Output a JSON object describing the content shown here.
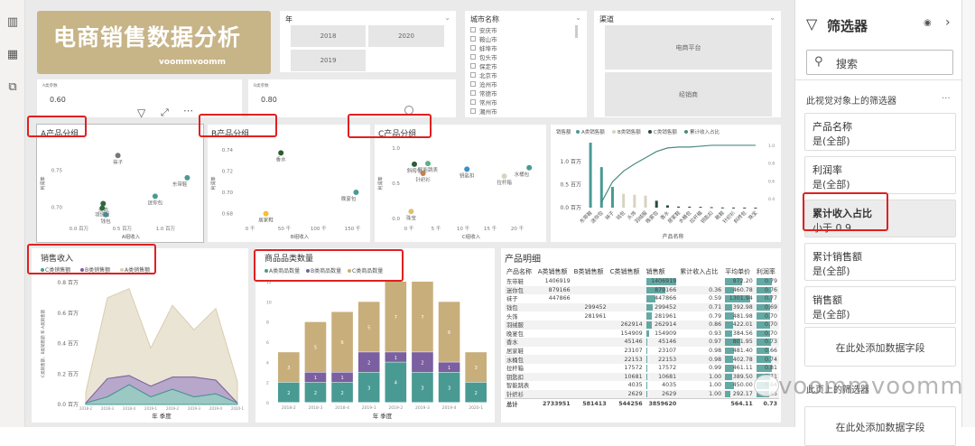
{
  "nav": {
    "icons": [
      "report-view-icon",
      "table-view-icon",
      "model-view-icon"
    ]
  },
  "banner": {
    "title": "电商销售数据分析",
    "subtitle": "voommvoomm"
  },
  "year_slicer": {
    "title": "年",
    "options": [
      "2018",
      "2020",
      "2019"
    ]
  },
  "city_slicer": {
    "title": "城市名称",
    "items": [
      "安庆市",
      "鞍山市",
      "蚌埠市",
      "包头市",
      "保定市",
      "北京市",
      "沧州市",
      "常德市",
      "常州市",
      "潮州市"
    ]
  },
  "channel_slicer": {
    "title": "渠道",
    "options": [
      "电商平台",
      "经销商"
    ]
  },
  "param_a": {
    "label": "A类参数",
    "value": "0.60"
  },
  "param_b": {
    "label": "B类参数",
    "value": "0.80"
  },
  "scatters": [
    {
      "title": "A产品分组",
      "xlabel": "A组收入",
      "ylabel": "利润率",
      "xlim": [
        -0.15,
        1.35
      ],
      "ylim": [
        0.68,
        0.785
      ],
      "xticks": [
        [
          0,
          "0.0 百万"
        ],
        [
          0.5,
          "0.5 百万"
        ],
        [
          1.0,
          "1.0 百万"
        ]
      ],
      "yticks": [
        [
          0.7,
          "0.70"
        ],
        [
          0.75,
          "0.75"
        ]
      ],
      "points": [
        {
          "label": "袜子",
          "x": 0.45,
          "y": 0.77,
          "color": "#777777"
        },
        {
          "label": "迷你包",
          "x": 0.88,
          "y": 0.715,
          "color": "#4a9a94"
        },
        {
          "label": "头饰",
          "x": 0.28,
          "y": 0.705,
          "color": "#2e6b3a"
        },
        {
          "label": "羽绒服",
          "x": 0.27,
          "y": 0.699,
          "color": "#2e6b3a"
        },
        {
          "label": "钱包",
          "x": 0.31,
          "y": 0.69,
          "color": "#4a8a94"
        },
        {
          "label": "东带鞋",
          "x": 1.25,
          "y": 0.74,
          "color": "#4a9a94"
        }
      ]
    },
    {
      "title": "B产品分组",
      "xlabel": "B组收入",
      "ylabel": "利润率",
      "xlim": [
        -20,
        165
      ],
      "ylim": [
        0.672,
        0.745
      ],
      "xticks": [
        [
          0,
          "0 千"
        ],
        [
          50,
          "50 千"
        ],
        [
          100,
          "100 千"
        ],
        [
          150,
          "150 千"
        ]
      ],
      "yticks": [
        [
          0.68,
          "0.68"
        ],
        [
          0.7,
          "0.70"
        ],
        [
          0.72,
          "0.72"
        ],
        [
          0.74,
          "0.74"
        ]
      ],
      "points": [
        {
          "label": "香水",
          "x": 45,
          "y": 0.737,
          "color": "#2e5a2e"
        },
        {
          "label": "晚宴包",
          "x": 155,
          "y": 0.7,
          "color": "#4a9a94"
        },
        {
          "label": "居家鞋",
          "x": 23,
          "y": 0.68,
          "color": "#f2c12e"
        }
      ]
    },
    {
      "title": "C产品分组",
      "xlabel": "C组收入",
      "ylabel": "利润率",
      "xlim": [
        -1,
        24
      ],
      "ylim": [
        -0.05,
        1.05
      ],
      "xticks": [
        [
          0,
          "0 千"
        ],
        [
          5,
          "5 千"
        ],
        [
          10,
          "10 千"
        ],
        [
          15,
          "15 千"
        ],
        [
          20,
          "20 千"
        ]
      ],
      "yticks": [
        [
          0,
          "0.0"
        ],
        [
          0.5,
          "0.5"
        ],
        [
          1.0,
          "1.0"
        ]
      ],
      "points": [
        {
          "label": "智能跳表",
          "x": 3.5,
          "y": 0.78,
          "color": "#5ab08a"
        },
        {
          "label": "斜挎包",
          "x": 1,
          "y": 0.77,
          "color": "#2e5a3e"
        },
        {
          "label": "针织衫",
          "x": 2.6,
          "y": 0.64,
          "color": "#c4804e"
        },
        {
          "label": "钥匙扣",
          "x": 10.7,
          "y": 0.7,
          "color": "#3a8fc4"
        },
        {
          "label": "拉杆箱",
          "x": 17.6,
          "y": 0.6,
          "color": "#d8d3c0"
        },
        {
          "label": "水桶包",
          "x": 22.2,
          "y": 0.72,
          "color": "#4a9a94"
        },
        {
          "label": "珠宝",
          "x": 0.4,
          "y": 0.1,
          "color": "#e0c070"
        }
      ]
    }
  ],
  "pareto": {
    "legend_title": "销售额",
    "legend": [
      {
        "name": "A类销售额",
        "color": "#4a9a94"
      },
      {
        "name": "B类销售额",
        "color": "#d8d3c0"
      },
      {
        "name": "C类销售额",
        "color": "#2d4a3c"
      },
      {
        "name": "累计收入占比",
        "color": "#4a8a80"
      }
    ],
    "xlabel": "产品名称",
    "yticks": [
      [
        0,
        "0.0 百万"
      ],
      [
        0.5,
        "0.5 百万"
      ],
      [
        1.0,
        "1.0 百万"
      ]
    ],
    "y2ticks": [
      [
        0.4,
        "0.4"
      ],
      [
        0.6,
        "0.6"
      ],
      [
        0.8,
        "0.8"
      ],
      [
        1.0,
        "1.0"
      ]
    ],
    "categories": [
      "东带鞋",
      "迷你包",
      "袜子",
      "钱包",
      "头饰",
      "羽绒服",
      "晚宴包",
      "香水",
      "居家鞋",
      "水桶包",
      "拉杆箱",
      "钥匙扣",
      "靴鞋",
      "针织衫",
      "斜挎包",
      "珠宝"
    ],
    "values": [
      1.41,
      0.88,
      0.45,
      0.3,
      0.28,
      0.26,
      0.15,
      0.05,
      0.023,
      0.022,
      0.018,
      0.011,
      0.004,
      0.003,
      0.002,
      0.001
    ],
    "groups": [
      "A",
      "A",
      "A",
      "B",
      "B",
      "B",
      "C",
      "C",
      "C",
      "C",
      "C",
      "C",
      "C",
      "C",
      "C",
      "C"
    ],
    "cumulative": [
      null,
      0.36,
      0.59,
      0.71,
      0.79,
      0.86,
      0.93,
      0.97,
      0.98,
      0.98,
      0.99,
      1.0,
      1.0,
      1.0,
      1.0,
      1.0
    ]
  },
  "chart_data": [
    {
      "type": "area",
      "title": "销售收入",
      "xlabel": "年 季度",
      "ylabel": "C类销售额、B类销售额 和 A类销售额",
      "x": [
        "2018-2",
        "2018-3",
        "2018-4",
        "2019-1",
        "2019-2",
        "2019-3",
        "2019-4",
        "2020-1"
      ],
      "ylim": [
        0,
        0.8
      ],
      "yticks": [
        [
          0,
          "0.0 百万"
        ],
        [
          0.2,
          "0.2 百万"
        ],
        [
          0.4,
          "0.4 百万"
        ],
        [
          0.6,
          "0.6 百万"
        ],
        [
          0.8,
          "0.8 百万"
        ]
      ],
      "series": [
        {
          "name": "C类销售额",
          "color": "#4a9a94",
          "values": [
            0.01,
            0.05,
            0.13,
            0.05,
            0.1,
            0.05,
            0.07,
            0.01
          ]
        },
        {
          "name": "B类销售额",
          "color": "#7b5fa0",
          "values": [
            0,
            0.12,
            0.06,
            0.07,
            0.08,
            0.13,
            0.09,
            0
          ]
        },
        {
          "name": "A类销售额",
          "color": "#d9cdb0",
          "values": [
            0.07,
            0.53,
            0.57,
            0.25,
            0.47,
            0.31,
            0.47,
            0.14
          ]
        }
      ]
    },
    {
      "type": "bar",
      "stacked": true,
      "title": "商品品类数量",
      "xlabel": "年 季度",
      "x": [
        "2018-2",
        "2018-3",
        "2018-4",
        "2019-1",
        "2019-2",
        "2019-3",
        "2019-4",
        "2020-1"
      ],
      "ylim": [
        0,
        12
      ],
      "yticks": [
        0,
        2,
        4,
        6,
        8,
        10,
        12
      ],
      "series": [
        {
          "name": "A类商品数量",
          "color": "#4a9a94",
          "values": [
            2,
            2,
            2,
            3,
            4,
            3,
            3,
            2
          ]
        },
        {
          "name": "B类商品数量",
          "color": "#7b5fa0",
          "values": [
            0,
            1,
            1,
            2,
            1,
            2,
            1,
            0
          ]
        },
        {
          "name": "C类商品数量",
          "color": "#c8ae7a",
          "values": [
            3,
            5,
            6,
            5,
            7,
            7,
            6,
            3
          ]
        }
      ]
    }
  ],
  "table": {
    "title": "产品明细",
    "columns": [
      "产品名称",
      "A类销售额",
      "B类销售额",
      "C类销售额",
      "销售额",
      "累计收入占比",
      "平均单价",
      "利润率"
    ],
    "rows": [
      [
        "东带鞋",
        "1406919",
        "",
        "",
        "1406919",
        "",
        "872.20",
        "0.79"
      ],
      [
        "迷你包",
        "879166",
        "",
        "",
        "879166",
        "0.36",
        "460.78",
        "0.76"
      ],
      [
        "袜子",
        "447866",
        "",
        "",
        "447866",
        "0.59",
        "1301.94",
        "0.77"
      ],
      [
        "钱包",
        "",
        "299452",
        "",
        "299452",
        "0.71",
        "392.98",
        "0.69"
      ],
      [
        "头饰",
        "",
        "281961",
        "",
        "281961",
        "0.79",
        "481.98",
        "0.70"
      ],
      [
        "羽绒服",
        "",
        "",
        "262914",
        "262914",
        "0.86",
        "422.01",
        "0.70"
      ],
      [
        "晚宴包",
        "",
        "",
        "154909",
        "154909",
        "0.93",
        "384.56",
        "0.70"
      ],
      [
        "香水",
        "",
        "",
        "45146",
        "45146",
        "0.97",
        "801.95",
        "0.73"
      ],
      [
        "居家鞋",
        "",
        "",
        "23107",
        "23107",
        "0.98",
        "481.40",
        "0.66"
      ],
      [
        "水桶包",
        "",
        "",
        "22153",
        "22153",
        "0.98",
        "402.78",
        "0.74"
      ],
      [
        "拉杆箱",
        "",
        "",
        "17572",
        "17572",
        "0.99",
        "461.11",
        "0.81"
      ],
      [
        "钥匙扣",
        "",
        "",
        "10681",
        "10681",
        "1.00",
        "389.50",
        "0.71"
      ],
      [
        "智能跳表",
        "",
        "",
        "4035",
        "4035",
        "1.00",
        "450.00",
        "0.64"
      ],
      [
        "针织衫",
        "",
        "",
        "2629",
        "2629",
        "1.00",
        "292.17",
        "0.65"
      ]
    ],
    "total": [
      "总计",
      "2733951",
      "581413",
      "544256",
      "3859620",
      "",
      "564.11",
      "0.73"
    ]
  },
  "filter_pane": {
    "title": "筛选器",
    "search_placeholder": "搜索",
    "section": "此视觉对象上的筛选器",
    "more": "...",
    "cards": [
      {
        "name": "产品名称",
        "value": "是(全部)"
      },
      {
        "name": "利润率",
        "value": "是(全部)"
      },
      {
        "name": "累计收入占比",
        "value": "小于 0.9"
      },
      {
        "name": "累计销售额",
        "value": "是(全部)"
      },
      {
        "name": "销售额",
        "value": "是(全部)"
      }
    ],
    "add_field": "在此处添加数据字段",
    "page_section": "此页上的筛选器",
    "add_field2": "在此处添加数据字段"
  },
  "watermark": "voommvoomm"
}
